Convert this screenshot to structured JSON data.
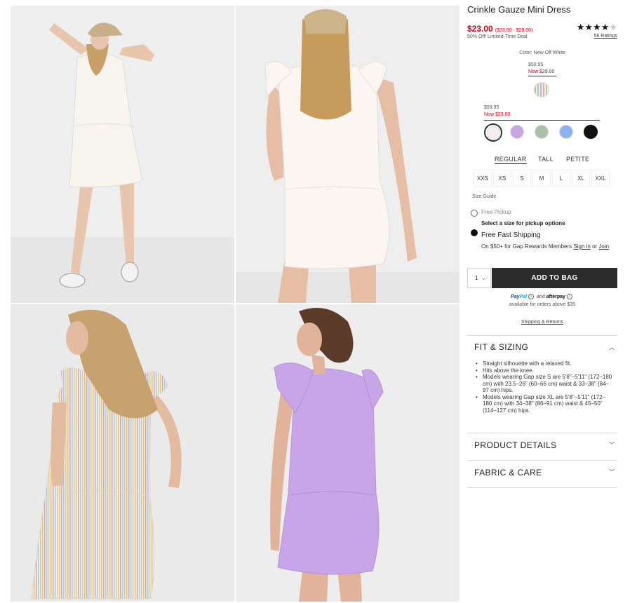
{
  "product": {
    "title": "Crinkle Gauze Mini Dress",
    "price": "$23.00",
    "price_range": "($23.00 - $29.00)",
    "deal": "50% Off! Limited-Time Deal",
    "rating_stars": 4,
    "rating_max": 5,
    "ratings_text": "56 Ratings"
  },
  "images": [
    {
      "alt": "model-front-white-dress-cap"
    },
    {
      "alt": "model-back-white-dress"
    },
    {
      "alt": "model-back-rainbow-stripe-dress"
    },
    {
      "alt": "model-back-lavender-dress"
    }
  ],
  "colors": {
    "label": "Color: New Off White",
    "tier1_old": "$59.95",
    "tier1_now": "Now $29.00",
    "tier2_old": "$59.95",
    "tier2_now": "Now $23.00",
    "swatch_tier1": [
      {
        "name": "rainbow-stripe",
        "color": "#e8d8c8"
      }
    ],
    "swatch_tier2": [
      {
        "name": "new-off-white",
        "color": "#f4eeee",
        "selected": true
      },
      {
        "name": "lavender",
        "color": "#c7a6e6",
        "selected": false
      },
      {
        "name": "sage",
        "color": "#a9c2a6",
        "selected": false
      },
      {
        "name": "light-blue",
        "color": "#8db3ec",
        "selected": false
      },
      {
        "name": "black",
        "color": "#111111",
        "selected": false
      }
    ]
  },
  "fit_tabs": [
    "REGULAR",
    "TALL",
    "PETITE"
  ],
  "sizes": [
    "XXS",
    "XS",
    "S",
    "M",
    "L",
    "XL",
    "XXL"
  ],
  "size_guide": "Size Guide",
  "fulfillment": {
    "pickup": "Free Pickup",
    "pickup_sub": "Select a size for pickup options",
    "shipping": "Free Fast Shipping",
    "shipping_sub_pre": "On $50+ for Gap Rewards Members ",
    "sign_in": "Sign in",
    "or": " or ",
    "join": "Join"
  },
  "cart": {
    "qty": "1",
    "add_label": "ADD TO BAG"
  },
  "payment": {
    "paypal_a": "Pay",
    "paypal_b": "Pal",
    "and": "and",
    "afterpay": "afterpay",
    "available": "available for orders above $35",
    "shipping_returns": "Shipping & Returns"
  },
  "accordions": {
    "fit_title": "FIT & SIZING",
    "fit_items": [
      "Straight silhouette with a relaxed fit.",
      "Hits above the knee.",
      "Models wearing Gap size S are 5'8\"–5'11\" (172–180 cm) with 23.5–26\" (60–66 cm) waist & 33–38\" (84–97 cm) hips.",
      "Models wearing Gap size XL are 5'8\"–5'11\" (172–180 cm) with 34–38\" (86–91 cm) waist & 45–50\" (114–127 cm) hips."
    ],
    "details_title": "PRODUCT DETAILS",
    "fabric_title": "FABRIC & CARE"
  }
}
